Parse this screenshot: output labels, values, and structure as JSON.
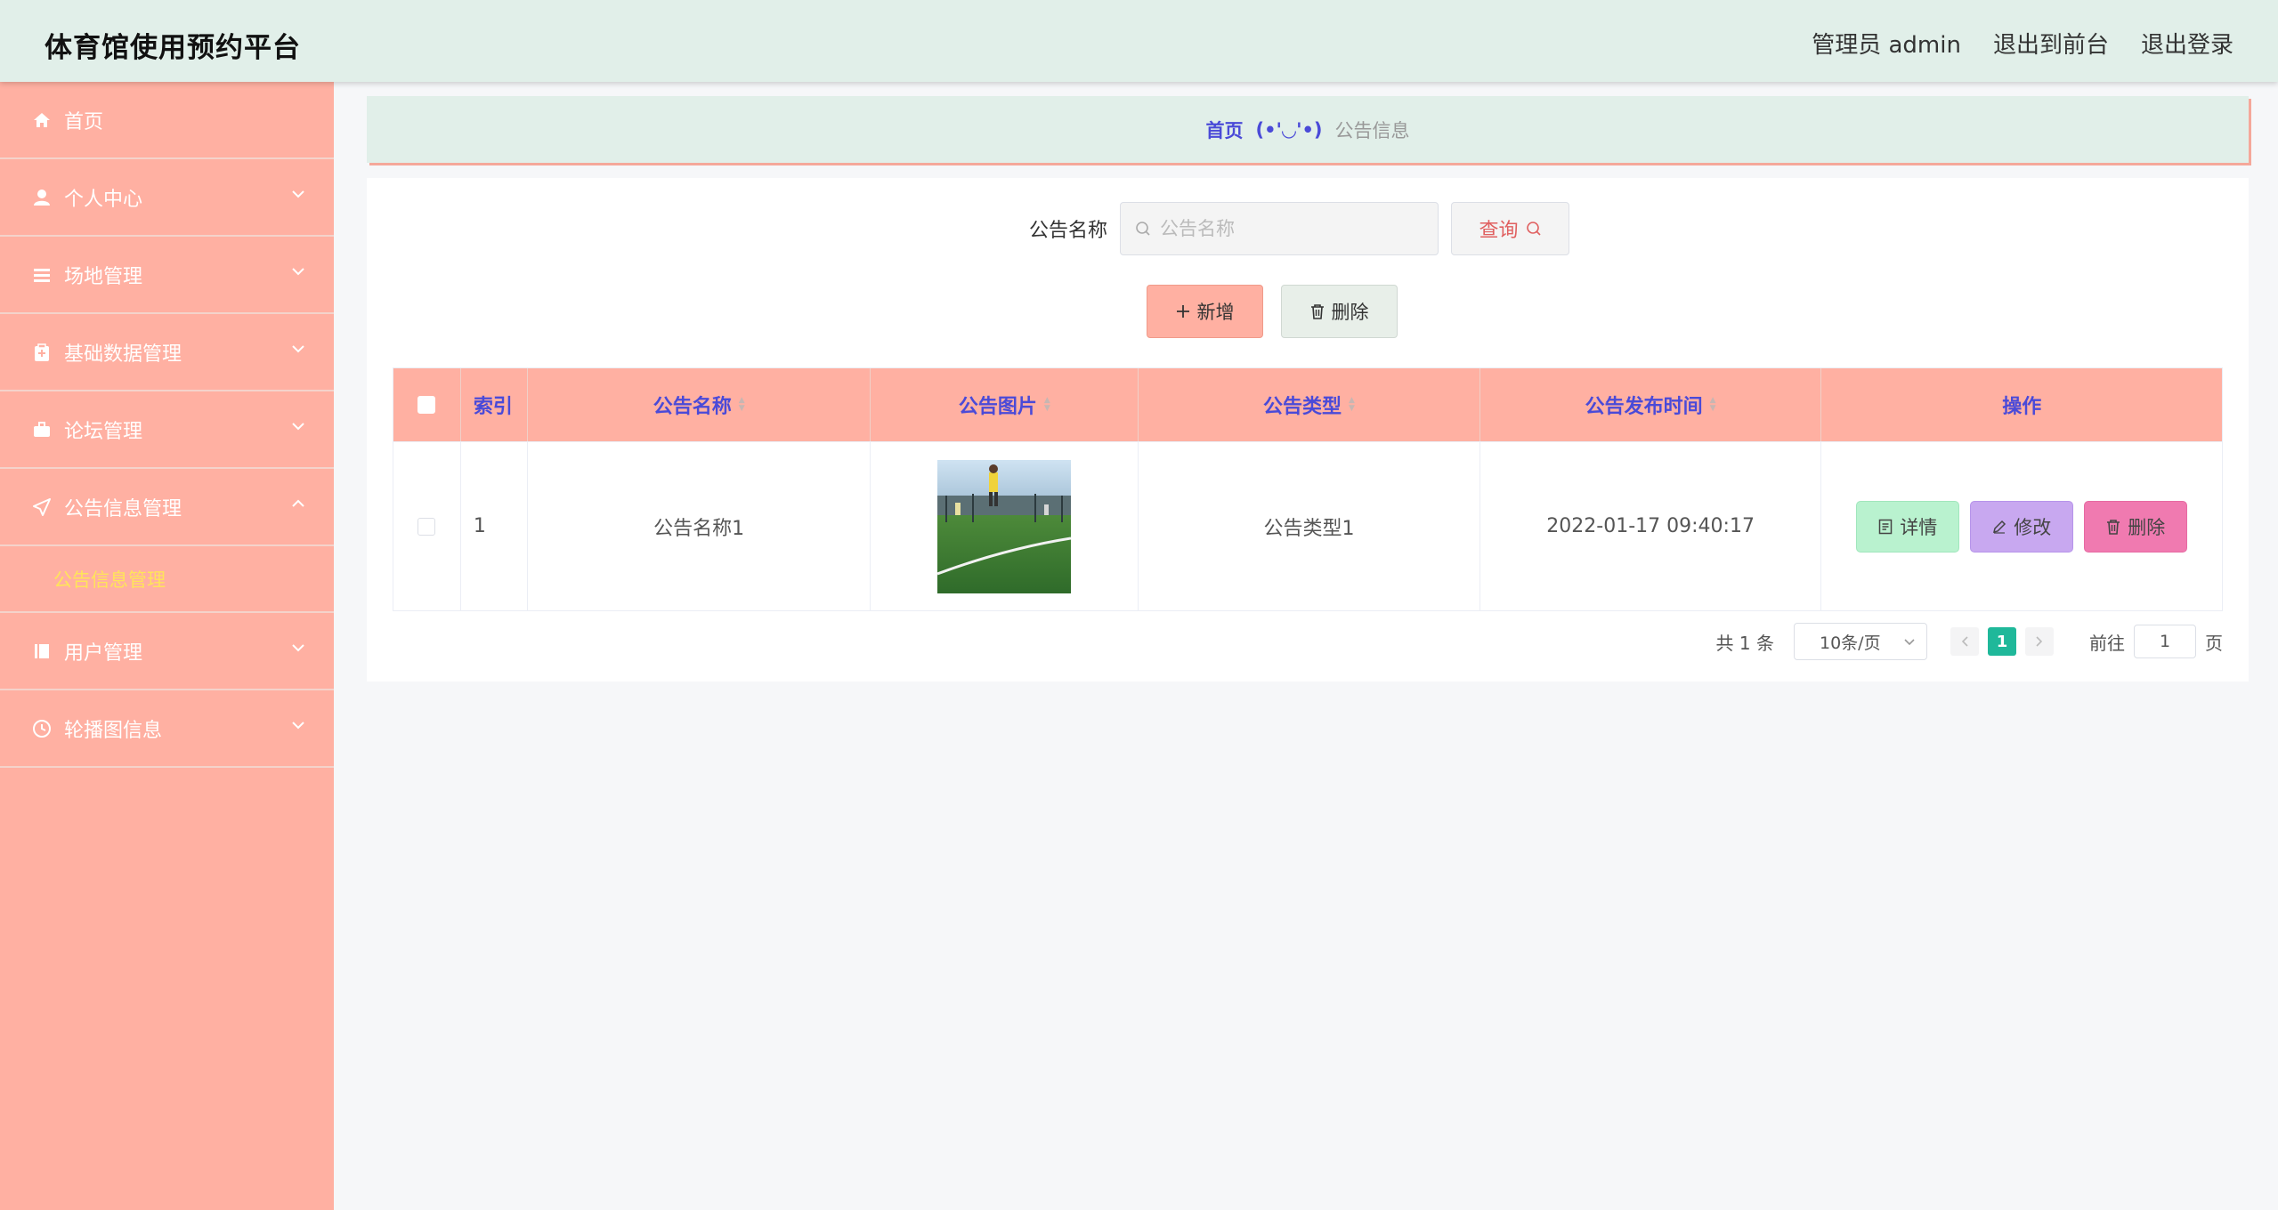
{
  "header": {
    "title": "体育馆使用预约平台",
    "admin_label": "管理员 admin",
    "front_link": "退出到前台",
    "logout_link": "退出登录",
    "bg_color": "#e1efe9"
  },
  "sidebar": {
    "bg_color": "#ffb0a2",
    "items": [
      {
        "label": "首页",
        "icon": "home-icon"
      },
      {
        "label": "个人中心",
        "icon": "user-icon"
      },
      {
        "label": "场地管理",
        "icon": "list-icon"
      },
      {
        "label": "基础数据管理",
        "icon": "clipboard-icon"
      },
      {
        "label": "论坛管理",
        "icon": "briefcase-icon"
      },
      {
        "label": "公告信息管理",
        "icon": "send-icon"
      },
      {
        "label": "用户管理",
        "icon": "book-icon"
      },
      {
        "label": "轮播图信息",
        "icon": "clock-icon"
      }
    ],
    "submenu_active": "公告信息管理"
  },
  "breadcrumb": {
    "home": "首页",
    "face": "(•'◡'•)",
    "current": "公告信息"
  },
  "search": {
    "label": "公告名称",
    "placeholder": "公告名称",
    "query_label": "查询"
  },
  "actions": {
    "add_label": "新增",
    "delete_label": "删除"
  },
  "table": {
    "columns": [
      "索引",
      "公告名称",
      "公告图片",
      "公告类型",
      "公告发布时间",
      "操作"
    ],
    "rows": [
      {
        "index": "1",
        "name": "公告名称1",
        "type": "公告类型1",
        "time": "2022-01-17 09:40:17"
      }
    ],
    "ops": {
      "detail": "详情",
      "edit": "修改",
      "delete": "删除"
    }
  },
  "pagination": {
    "total": "共 1 条",
    "page_size": "10条/页",
    "current_page": "1",
    "goto_label": "前往",
    "goto_value": "1",
    "page_suffix": "页",
    "active_color": "#1fb89a"
  }
}
